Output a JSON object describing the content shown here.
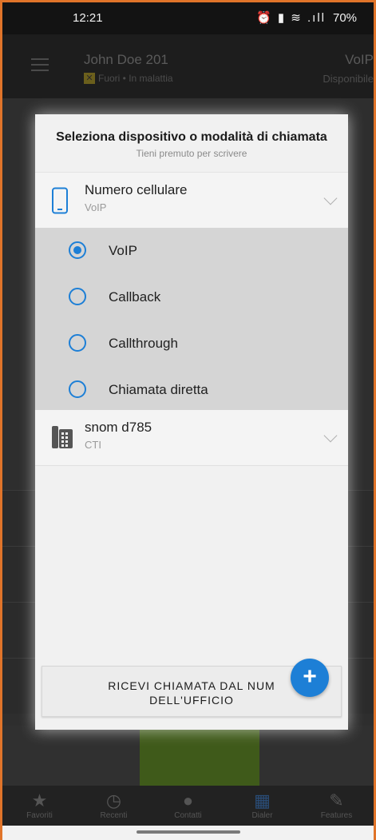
{
  "status_bar": {
    "time": "12:21",
    "icons": "⏰ ▮ ≋ .ıll",
    "battery": "70%"
  },
  "app_header": {
    "user_name": "John Doe 201",
    "user_status": "Fuori • In malattia",
    "mode": "VoIP",
    "mode_status": "Disponibile"
  },
  "dialog": {
    "title": "Seleziona dispositivo o modalità di chiamata",
    "subtitle": "Tieni premuto per scrivere",
    "devices": [
      {
        "name": "Numero cellulare",
        "mode": "VoIP",
        "icon": "smartphone-icon"
      },
      {
        "name": "snom d785",
        "mode": "CTI",
        "icon": "desk-phone-icon"
      }
    ],
    "options": [
      {
        "label": "VoIP",
        "selected": true
      },
      {
        "label": "Callback",
        "selected": false
      },
      {
        "label": "Callthrough",
        "selected": false
      },
      {
        "label": "Chiamata diretta",
        "selected": false
      }
    ],
    "receive_button_line1": "RICEVI CHIAMATA DAL NUM",
    "receive_button_line2": "DELL'UFFICIO",
    "fab_label": "+"
  },
  "nav": {
    "items": [
      {
        "label": "Favoriti",
        "glyph": "★"
      },
      {
        "label": "Recenti",
        "glyph": "◷"
      },
      {
        "label": "Contatti",
        "glyph": "●"
      },
      {
        "label": "Dialer",
        "glyph": "▦"
      },
      {
        "label": "Features",
        "glyph": "✎"
      }
    ]
  },
  "colors": {
    "accent": "#1d7fd6",
    "frame": "#e0742a",
    "options_bg": "#d5d5d5"
  }
}
